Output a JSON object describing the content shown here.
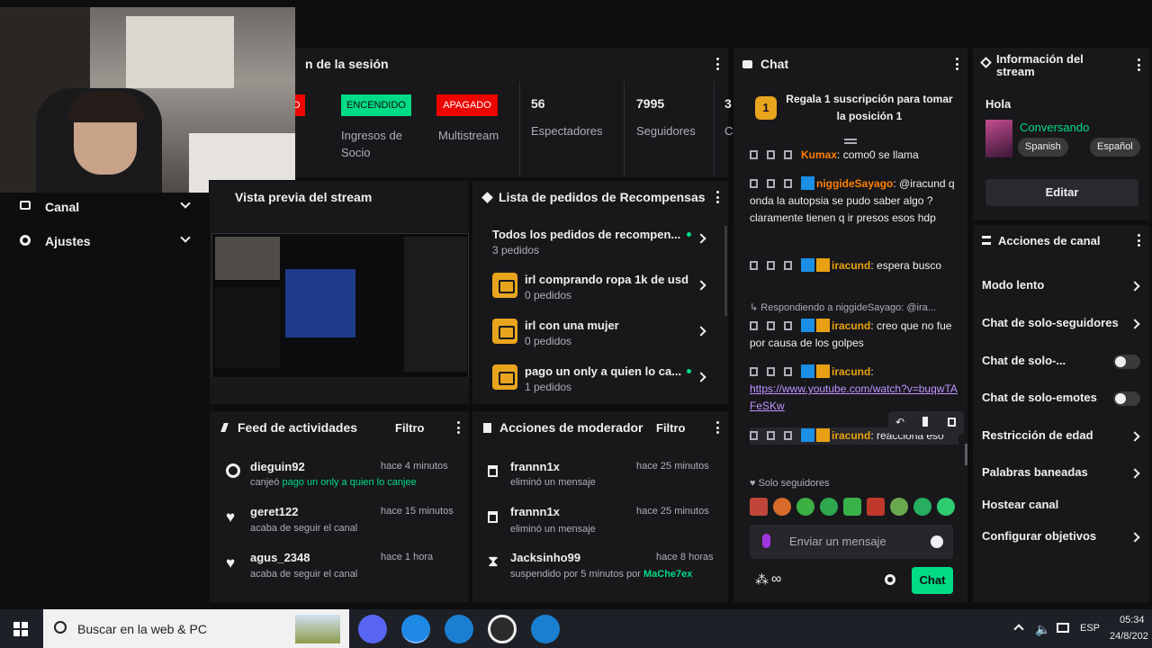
{
  "session": {
    "title": "n de la sesión",
    "partner_badge": "DO",
    "partner_label_state": "ENCENDIDO",
    "partner_label": "Ingresos de Socio",
    "multistream_state": "APAGADO",
    "multistream_label": "Multistream",
    "viewers_value": "56",
    "viewers_label": "Espectadores",
    "followers_value": "7995",
    "followers_label": "Seguidores",
    "extra_value": "3",
    "extra_label": "C"
  },
  "nav": {
    "items": [
      {
        "label": "Canal"
      },
      {
        "label": "Ajustes"
      }
    ]
  },
  "preview": {
    "title": "Vista previa del stream"
  },
  "rewards": {
    "title": "Lista de pedidos de Recompensas",
    "items": [
      {
        "name": "Todos los pedidos de recompen...",
        "count": "3 pedidos"
      },
      {
        "name": "irl comprando ropa 1k de usd",
        "count": "0 pedidos"
      },
      {
        "name": "irl con una mujer",
        "count": "0 pedidos"
      },
      {
        "name": "pago un only a quien lo ca...",
        "count": "1 pedidos"
      }
    ]
  },
  "activity": {
    "title": "Feed de actividades",
    "filter": "Filtro",
    "items": [
      {
        "user": "dieguin92",
        "time": "hace 4 minutos",
        "prefix": "canjeó ",
        "action": "pago un only a quien lo canjee"
      },
      {
        "user": "geret122",
        "time": "hace 15 minutos",
        "prefix": "",
        "action": "acaba de seguir el canal"
      },
      {
        "user": "agus_2348",
        "time": "hace 1 hora",
        "prefix": "",
        "action": "acaba de seguir el canal"
      }
    ]
  },
  "modactions": {
    "title": "Acciones de moderador",
    "filter": "Filtro",
    "items": [
      {
        "user": "frannn1x",
        "time": "hace 25 minutos",
        "action": "eliminó un mensaje",
        "by": ""
      },
      {
        "user": "frannn1x",
        "time": "hace 25 minutos",
        "action": "eliminó un mensaje",
        "by": ""
      },
      {
        "user": "Jacksinho99",
        "time": "hace 8 horas",
        "action": "suspendido por 5 minutos por ",
        "by": "MaChe7ex"
      }
    ]
  },
  "chat": {
    "title": "Chat",
    "gift_rank": "1",
    "gift_text": "Regala 1 suscripción para tomar la posición 1",
    "messages": [
      {
        "user": "Kumax",
        "text": "como0 se llama"
      },
      {
        "user": "niggideSayago",
        "text": "@iracund q onda la autopsia se pudo saber algo ? claramente tienen q ir presos esos hdp"
      },
      {
        "user": "iracund",
        "text": "espera busco"
      },
      {
        "reply": "Respondiendo a niggideSayago: @ira...",
        "user": "iracund",
        "text": "creo que no fue por causa de los golpes"
      },
      {
        "user": "iracund",
        "link": "https://www.youtube.com/watch?v=buqwTAFeSKw"
      },
      {
        "user": "iracund",
        "text": "reacciona eso"
      }
    ],
    "followers_only": "Solo seguidores",
    "input_placeholder": "Enviar un mensaje",
    "send_label": "Chat"
  },
  "info": {
    "title": "Información del stream",
    "greeting": "Hola",
    "category": "Conversando",
    "tags": [
      "Spanish",
      "Español"
    ],
    "edit_label": "Editar"
  },
  "channel_actions": {
    "title": "Acciones de canal",
    "items": [
      {
        "label": "Modo lento",
        "kind": "chevron"
      },
      {
        "label": "Chat de solo-seguidores",
        "kind": "chevron"
      },
      {
        "label": "Chat de solo-...",
        "kind": "toggle"
      },
      {
        "label": "Chat de solo-emotes",
        "kind": "toggle"
      },
      {
        "label": "Restricción de edad",
        "kind": "chevron"
      },
      {
        "label": "Palabras baneadas",
        "kind": "chevron"
      },
      {
        "label": "Hostear canal",
        "kind": "none"
      },
      {
        "label": "Configurar objetivos",
        "kind": "chevron"
      }
    ]
  },
  "taskbar": {
    "search_placeholder": "Buscar en la web & PC",
    "lang": "ESP",
    "time": "05:34",
    "date": "24/8/202"
  },
  "colors": {
    "accent_green": "#00db84",
    "off_red": "#eb0400",
    "sub_blue": "#1b8ee5",
    "gold": "#e9a41e"
  }
}
